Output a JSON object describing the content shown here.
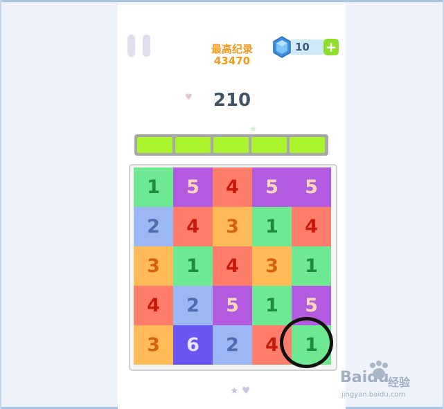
{
  "hud": {
    "best_label": "最高纪录",
    "best_value": "43470",
    "gems": "10",
    "plus": "+",
    "score": "210"
  },
  "progress": {
    "segments_filled": 5,
    "segments_total": 5
  },
  "board": {
    "rows": [
      [
        "1",
        "5",
        "4",
        "5",
        "5"
      ],
      [
        "2",
        "4",
        "3",
        "1",
        "4"
      ],
      [
        "3",
        "1",
        "4",
        "3",
        "1"
      ],
      [
        "4",
        "2",
        "5",
        "1",
        "5"
      ],
      [
        "3",
        "6",
        "2",
        "4",
        "1"
      ]
    ],
    "highlighted": {
      "row": 4,
      "col": 4
    }
  },
  "tile_colors": {
    "1": {
      "bg": "#6ee891",
      "fg": "#1e8a3c"
    },
    "2": {
      "bg": "#9db7f5",
      "fg": "#4f6cb0"
    },
    "3": {
      "bg": "#ffbb57",
      "fg": "#d8610b"
    },
    "4": {
      "bg": "#ff7e6b",
      "fg": "#c8190a"
    },
    "5": {
      "bg": "#b35be0",
      "fg": "#ffd9b8"
    },
    "6": {
      "bg": "#6a55f2",
      "fg": "#e9e4ff"
    }
  },
  "watermark": {
    "brand": "Bai",
    "brand2": "du",
    "cn": "经验",
    "url": "jingyan.baidu.com"
  }
}
